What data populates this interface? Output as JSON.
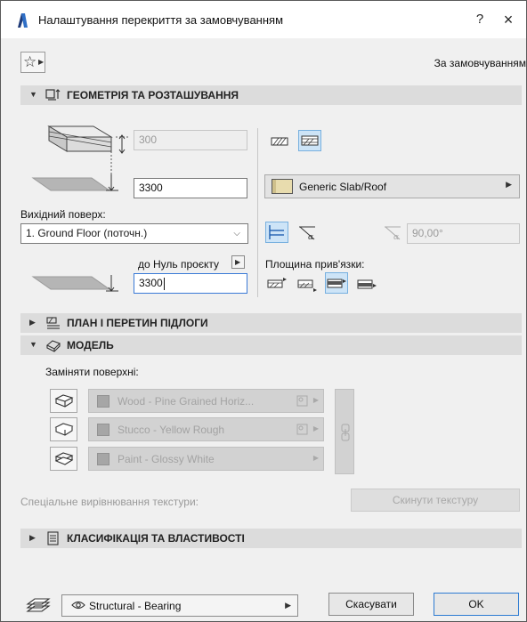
{
  "window": {
    "title": "Налаштування перекриття за замовчуванням",
    "help": "?",
    "close": "×"
  },
  "favorites": {
    "preset_name": "За замовчуванням"
  },
  "sections": {
    "geometry": {
      "title": "ГЕОМЕТРІЯ ТА РОЗТАШУВАННЯ",
      "expanded": true
    },
    "floor_plan": {
      "title": "ПЛАН І ПЕРЕТИН ПІДЛОГИ",
      "expanded": false
    },
    "model": {
      "title": "МОДЕЛЬ",
      "expanded": true
    },
    "classification": {
      "title": "КЛАСИФІКАЦІЯ ТА ВЛАСТИВОСТІ",
      "expanded": false
    }
  },
  "geometry": {
    "thickness": "300",
    "elevation": "3300",
    "home_story_label": "Вихідний поверх:",
    "home_story_value": "1. Ground Floor (поточн.)",
    "reference_label": "до Нуль проєкту",
    "reference_value": "3300",
    "building_material": "Generic Slab/Roof",
    "angle_value": "90,00°",
    "reference_plane_label": "Площина прив'язки:"
  },
  "model": {
    "override_label": "Заміняти поверхні:",
    "surfaces": [
      {
        "name": "Wood - Pine Grained Horiz..."
      },
      {
        "name": "Stucco - Yellow Rough"
      },
      {
        "name": "Paint - Glossy White"
      }
    ],
    "texture_label": "Спеціальне вирівнювання текстури:",
    "reset_texture": "Скинути текстуру"
  },
  "footer": {
    "layer": "Structural - Bearing",
    "cancel": "Скасувати",
    "ok": "OK"
  },
  "colors": {
    "accent": "#2d7bd2",
    "selected_bg": "#cde4f7",
    "section_bg": "#dcdcdc"
  }
}
